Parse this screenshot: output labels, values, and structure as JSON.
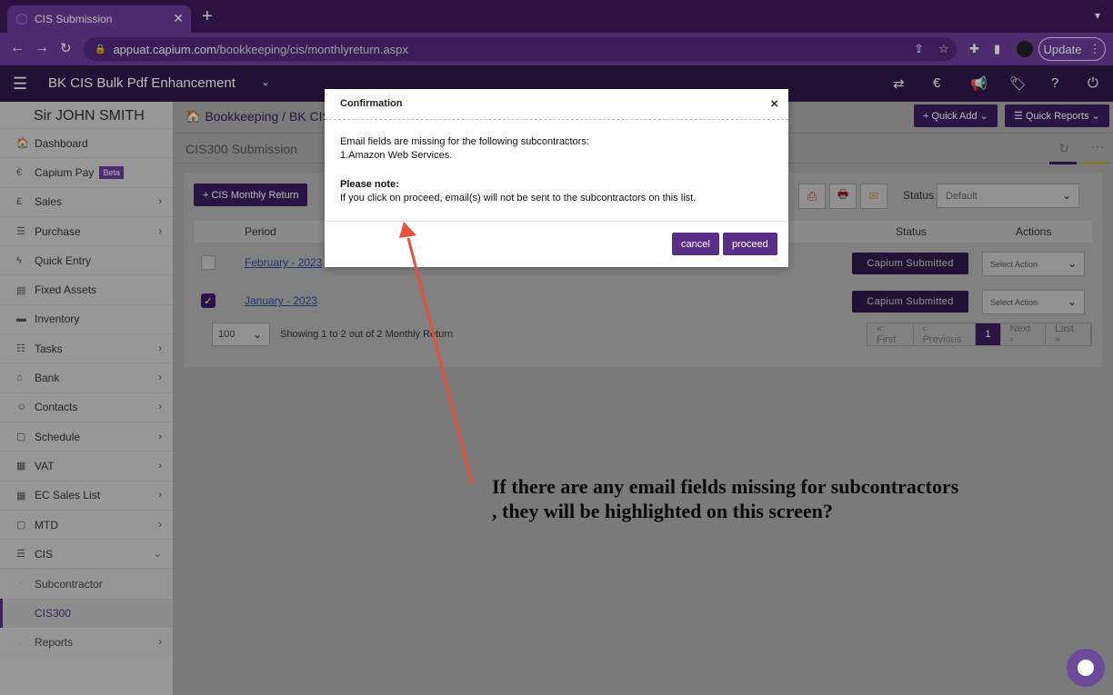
{
  "browser": {
    "tab_title": "CIS Submission",
    "new_tab": "+",
    "url_host": "appuat.capium.com",
    "url_path": "/bookkeeping/cis/monthlyreturn.aspx",
    "update_label": "Update"
  },
  "app": {
    "title": "BK CIS Bulk Pdf Enhancement"
  },
  "sidebar": {
    "user": "Sir JOHN SMITH",
    "beta": "Beta",
    "items": [
      {
        "label": "Dashboard",
        "icon": "home-icon",
        "glyph": "🏠",
        "chev": false
      },
      {
        "label": "Capium Pay",
        "icon": "capium-icon",
        "glyph": "€",
        "chev": false
      },
      {
        "label": "Sales",
        "icon": "pound-icon",
        "glyph": "£",
        "chev": true
      },
      {
        "label": "Purchase",
        "icon": "list-icon",
        "glyph": "☰",
        "chev": true
      },
      {
        "label": "Quick Entry",
        "icon": "bolt-icon",
        "glyph": "ϟ",
        "chev": false
      },
      {
        "label": "Fixed Assets",
        "icon": "building-icon",
        "glyph": "▤",
        "chev": false
      },
      {
        "label": "Inventory",
        "icon": "truck-icon",
        "glyph": "▬",
        "chev": false
      },
      {
        "label": "Tasks",
        "icon": "tasks-icon",
        "glyph": "☷",
        "chev": true
      },
      {
        "label": "Bank",
        "icon": "bank-icon",
        "glyph": "⌂",
        "chev": true
      },
      {
        "label": "Contacts",
        "icon": "users-icon",
        "glyph": "☺",
        "chev": true
      },
      {
        "label": "Schedule",
        "icon": "calendar-icon",
        "glyph": "▢",
        "chev": true
      },
      {
        "label": "VAT",
        "icon": "calculator-icon",
        "glyph": "▦",
        "chev": true
      },
      {
        "label": "EC Sales List",
        "icon": "calculator-icon",
        "glyph": "▦",
        "chev": true
      },
      {
        "label": "MTD",
        "icon": "calendar-icon",
        "glyph": "▢",
        "chev": true
      },
      {
        "label": "CIS",
        "icon": "cis-icon",
        "glyph": "☰",
        "chev": "down"
      }
    ],
    "subitems": [
      {
        "label": "Subcontractor",
        "active": false,
        "chev": false
      },
      {
        "label": "CIS300",
        "active": true,
        "chev": false
      },
      {
        "label": "Reports",
        "active": false,
        "chev": true
      }
    ]
  },
  "main": {
    "breadcrumb_home": "Bookkeeping",
    "breadcrumb_sep": "/",
    "breadcrumb_current": "BK CIS E",
    "quick_add": "Quick Add",
    "quick_reports": "Quick Reports",
    "page_title": "CIS300 Submission",
    "cis_button": "CIS Monthly Return",
    "status_label": "Status",
    "status_value": "Default",
    "columns": {
      "period": "Period",
      "status": "Status",
      "actions": "Actions"
    },
    "rows": [
      {
        "period": "February - 2023",
        "checked": false,
        "status": "Capium Submitted",
        "action": "Select Action"
      },
      {
        "period": "January - 2023",
        "checked": true,
        "status": "Capium Submitted",
        "action": "Select Action"
      }
    ],
    "page_size": "100",
    "showing": "Showing 1 to 2 out of 2 Monthly Return",
    "pager": {
      "first": "« First",
      "prev": "‹ Previous",
      "current": "1",
      "next": "Next ›",
      "last": "Last »"
    }
  },
  "modal": {
    "title": "Confirmation",
    "close": "×",
    "line1": "Email fields are missing for the following subcontractors:",
    "line2": "1.Amazon Web Services.",
    "note_title": "Please note:",
    "note_text": "If you click on proceed, email(s) will not be sent to the subcontractors on this list.",
    "cancel": "cancel",
    "proceed": "proceed"
  },
  "annotation": {
    "text": "If there are any email fields missing for subcontractors\n, they will be highlighted on this screen?",
    "arrow_color": "#e8503a"
  },
  "colors": {
    "brand": "#6a3d9a",
    "dark": "#2e1a4a",
    "accent": "#3b1d5e"
  }
}
